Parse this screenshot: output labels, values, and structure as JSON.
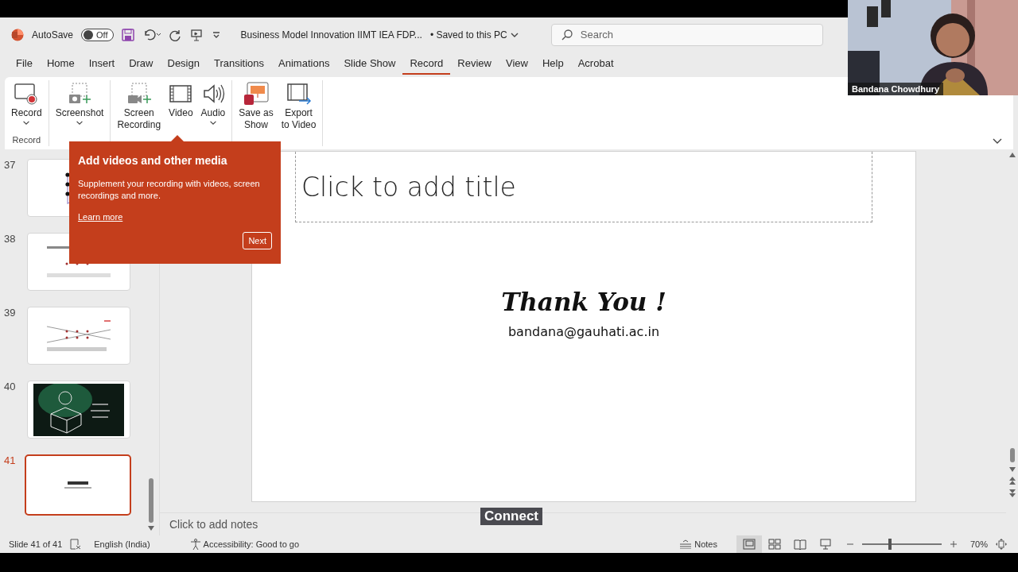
{
  "title_bar": {
    "autosave_label": "AutoSave",
    "autosave": {
      "on": false,
      "label": "Off"
    },
    "document_title": "Business Model Innovation IIMT IEA FDP...",
    "save_status": "• Saved to this PC",
    "search": {
      "placeholder": "Search"
    }
  },
  "tabs": [
    {
      "label": "File",
      "selected": false
    },
    {
      "label": "Home",
      "selected": false
    },
    {
      "label": "Insert",
      "selected": false
    },
    {
      "label": "Draw",
      "selected": false
    },
    {
      "label": "Design",
      "selected": false
    },
    {
      "label": "Transitions",
      "selected": false
    },
    {
      "label": "Animations",
      "selected": false
    },
    {
      "label": "Slide Show",
      "selected": false
    },
    {
      "label": "Record",
      "selected": true
    },
    {
      "label": "Review",
      "selected": false
    },
    {
      "label": "View",
      "selected": false
    },
    {
      "label": "Help",
      "selected": false
    },
    {
      "label": "Acrobat",
      "selected": false
    }
  ],
  "ribbon": {
    "groups": [
      {
        "label": "Record",
        "buttons": [
          {
            "kind": "record",
            "label": "Record",
            "dropdown": true
          }
        ]
      },
      {
        "buttons": [
          {
            "kind": "screenshot",
            "label": "Screenshot",
            "dropdown": true
          }
        ]
      },
      {
        "buttons": [
          {
            "kind": "screen-recording",
            "label": "Screen\nRecording",
            "dropdown": false
          },
          {
            "kind": "video",
            "label": "Video",
            "dropdown": false
          },
          {
            "kind": "audio",
            "label": "Audio",
            "dropdown": true
          }
        ]
      },
      {
        "buttons": [
          {
            "kind": "save-show",
            "label": "Save as\nShow",
            "dropdown": false
          },
          {
            "kind": "export-video",
            "label": "Export\nto Video",
            "dropdown": false
          }
        ]
      }
    ]
  },
  "slides": [
    {
      "number": "37",
      "kind": "diagram",
      "selected": false
    },
    {
      "number": "38",
      "kind": "dots",
      "selected": false
    },
    {
      "number": "39",
      "kind": "lines",
      "selected": false
    },
    {
      "number": "40",
      "kind": "picture",
      "selected": false
    },
    {
      "number": "41",
      "kind": "title",
      "selected": true
    }
  ],
  "slide": {
    "title_placeholder": "Click to add title",
    "heading": "Thank You !",
    "email": "bandana@gauhati.ac.in"
  },
  "notes_placeholder": "Click to add notes",
  "coachmark": {
    "title": "Add videos and other media",
    "body": "Supplement your recording with videos, screen recordings and more.",
    "link": "Learn more",
    "button": "Next"
  },
  "video": {
    "kind": "picture",
    "name": "Bandana Chowdhury"
  },
  "overlay_label": "Connect",
  "status_bar": {
    "slide_info": "Slide 41 of 41",
    "language": "English (India)",
    "accessibility": "Accessibility: Good to go",
    "notes": "Notes",
    "views": [
      {
        "kind": "normal",
        "selected": true
      },
      {
        "kind": "sorter",
        "selected": false
      },
      {
        "kind": "reading",
        "selected": false
      },
      {
        "kind": "slideshow",
        "selected": false
      }
    ],
    "zoom": {
      "level": 0.35,
      "label": "70%"
    }
  }
}
